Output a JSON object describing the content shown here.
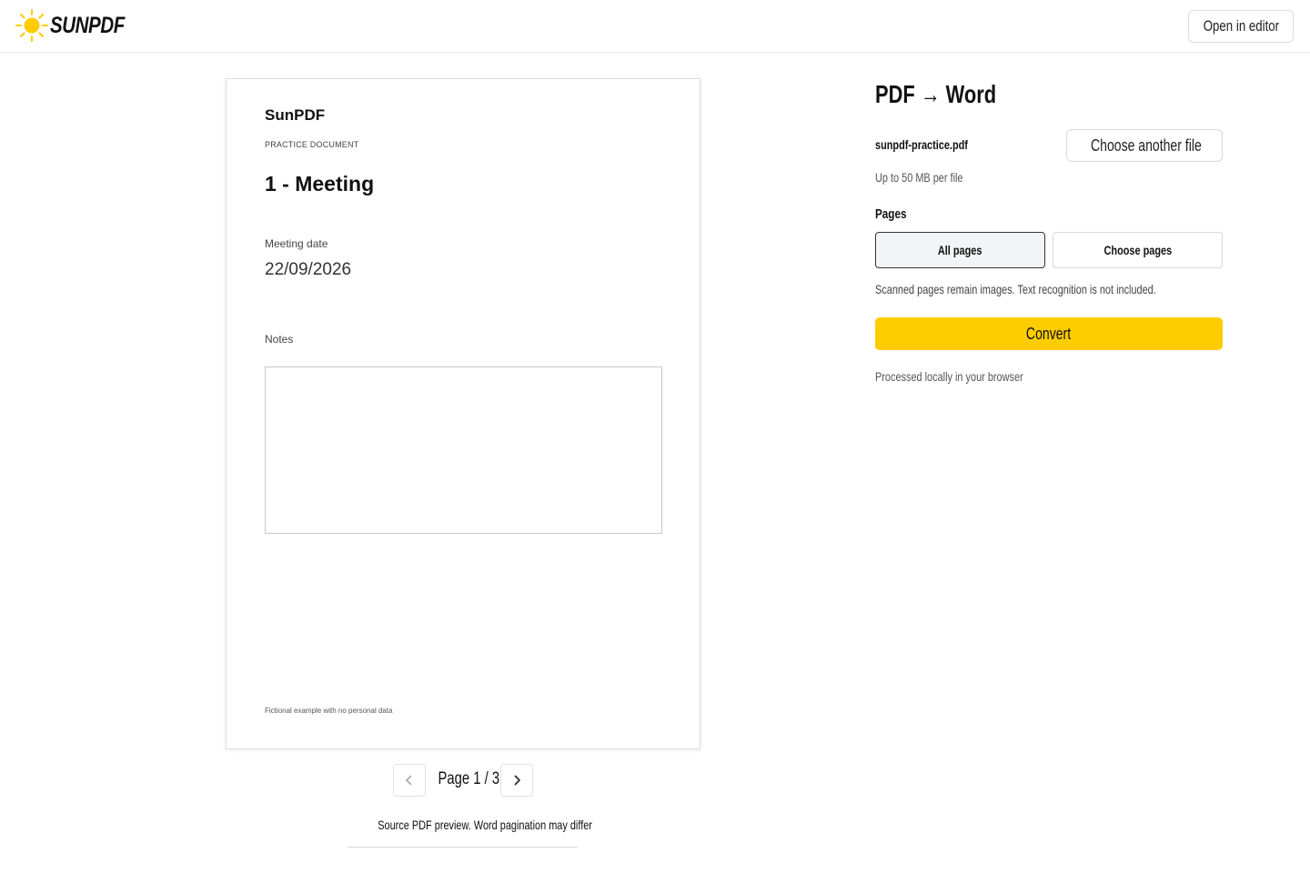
{
  "brand": {
    "logo_text": "SUNPDF",
    "accent": "#ffcc00"
  },
  "header": {
    "open_editor_label": "Open in editor"
  },
  "document": {
    "brand": "SunPDF",
    "kicker": "PRACTICE DOCUMENT",
    "title": "1 - Meeting",
    "date_label": "Meeting date",
    "date_value": "22/09/2026",
    "notes_label": "Notes",
    "footer": "Fictional example with no personal data"
  },
  "pager": {
    "label": "Page 1 / 3",
    "prev_icon": "chevron-left-icon",
    "next_icon": "chevron-right-icon"
  },
  "preview_note": "Source PDF preview. Word pagination may differ",
  "panel": {
    "title": "PDF → Word",
    "file_name": "sunpdf-practice.pdf",
    "choose_file_label": "Choose another file",
    "choose_file_icon": "file-upload-icon",
    "size_note": "Up to 50 MB per file",
    "pages_label": "Pages",
    "pages_options": [
      "All pages",
      "Choose pages"
    ],
    "pages_selected": "All pages",
    "scan_note": "Scanned pages remain images. Text recognition is not included.",
    "convert_label": "Convert",
    "local_note": "Processed locally in your browser"
  }
}
